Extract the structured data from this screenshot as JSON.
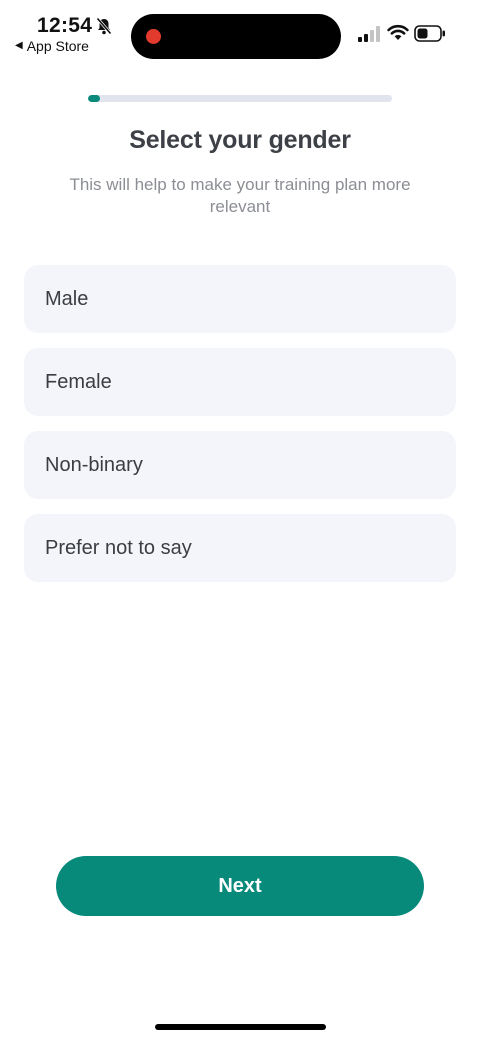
{
  "status_bar": {
    "time": "12:54",
    "back_label": "App Store",
    "back_glyph": "◀",
    "icons": [
      "bell-slash-icon",
      "signal-icon",
      "wifi-icon",
      "battery-icon"
    ],
    "recording_color": "#e23b2e"
  },
  "progress": {
    "fraction": 0.04,
    "fill_color": "#0a8a7a",
    "track_color": "#e1e4ed"
  },
  "title": "Select your gender",
  "subtitle": "This will help to make your training plan more relevant",
  "options": [
    {
      "label": "Male"
    },
    {
      "label": "Female"
    },
    {
      "label": "Non-binary"
    },
    {
      "label": "Prefer not to say"
    }
  ],
  "next_button": {
    "label": "Next",
    "color": "#088a7b"
  }
}
